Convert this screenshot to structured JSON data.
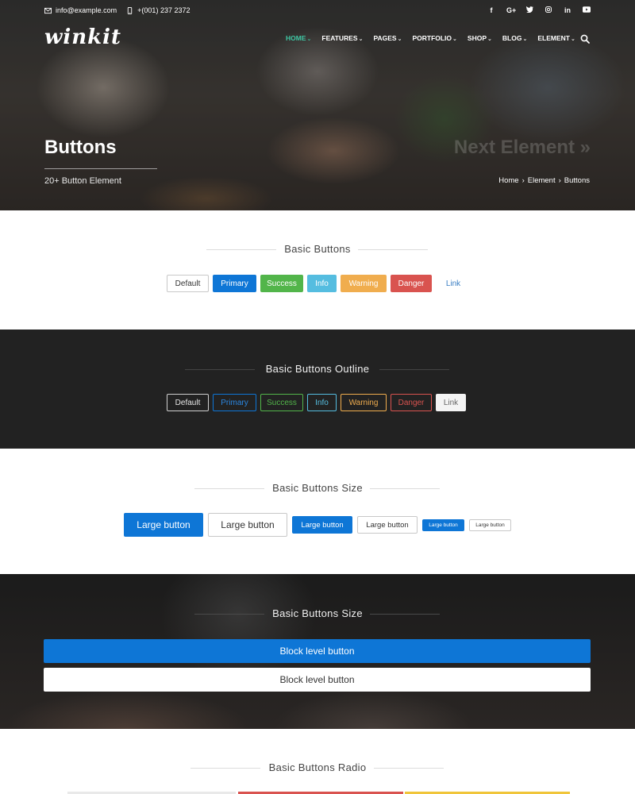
{
  "colors": {
    "primary": "#0e76d6",
    "success": "#52b54a",
    "info": "#55bde0",
    "warning": "#f0ad4e",
    "danger": "#d9534f",
    "link": "#3b7fc4",
    "accent_nav": "#3ec7a4",
    "dark_section": "#222222"
  },
  "topbar": {
    "email": "info@example.com",
    "phone": "+(001) 237 2372",
    "social": [
      "f",
      "G+",
      "t",
      "ig",
      "in",
      "yt"
    ]
  },
  "logo": "winkit",
  "nav": [
    {
      "label": "HOME",
      "active": true
    },
    {
      "label": "FEATURES",
      "active": false
    },
    {
      "label": "PAGES",
      "active": false
    },
    {
      "label": "PORTFOLIO",
      "active": false
    },
    {
      "label": "SHOP",
      "active": false
    },
    {
      "label": "BLOG",
      "active": false
    },
    {
      "label": "ELEMENT",
      "active": false
    }
  ],
  "hero": {
    "title": "Buttons",
    "subtitle": "20+ Button Element",
    "next_label": "Next Element »",
    "breadcrumb": [
      "Home",
      "Element",
      "Buttons"
    ],
    "breadcrumb_sep": "›"
  },
  "sections": {
    "basic": {
      "title": "Basic Buttons",
      "buttons": [
        "Default",
        "Primary",
        "Success",
        "Info",
        "Warning",
        "Danger",
        "Link"
      ]
    },
    "outline": {
      "title": "Basic Buttons Outline",
      "buttons": [
        "Default",
        "Primary",
        "Success",
        "Info",
        "Warning",
        "Danger",
        "Link"
      ]
    },
    "size": {
      "title": "Basic Buttons Size",
      "buttons": [
        "Large button",
        "Large button",
        "Large button",
        "Large button",
        "Large button",
        "Large button"
      ]
    },
    "block": {
      "title": "Basic Buttons Size",
      "buttons": [
        "Block level button",
        "Block level button"
      ]
    },
    "radio": {
      "title": "Basic Buttons Radio"
    }
  }
}
